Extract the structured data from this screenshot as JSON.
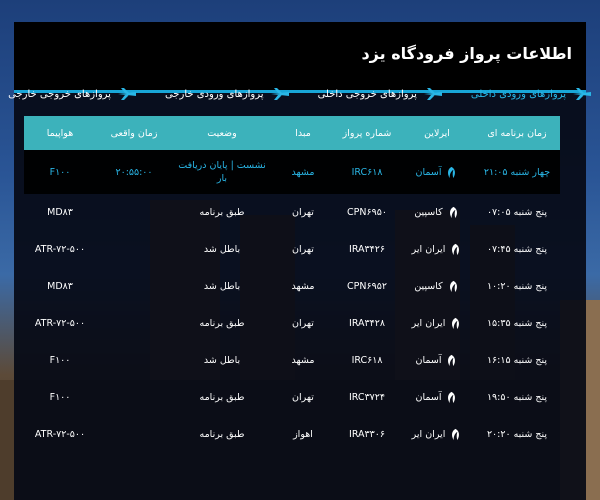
{
  "header": {
    "title": "اطلاعات پرواز فرودگاه یزد"
  },
  "tabs": [
    {
      "label": "پروازهای ورودی داخلی",
      "active": true
    },
    {
      "label": "پروازهای خروجی داخلی",
      "active": false
    },
    {
      "label": "پروازهای ورودی خارجی",
      "active": false
    },
    {
      "label": "پروازهای خروجی خارجی",
      "active": false
    }
  ],
  "table": {
    "columns": [
      "زمان برنامه ای",
      "ایرلاین",
      "شماره پرواز",
      "مبدا",
      "وضعیت",
      "زمان واقعی",
      "هواپیما"
    ],
    "rows": [
      {
        "scheduled": "چهار شنبه ۲۱:۰۵",
        "airline": "آسمان",
        "flight": "IRC۶۱۸",
        "origin": "مشهد",
        "status": "نشست | پایان دریافت بار",
        "actual": "۲۰:۵۵:۰۰",
        "aircraft": "F۱۰۰",
        "logo": "aseman-logo-icon"
      },
      {
        "scheduled": "پنج شنبه ۰۷:۰۵",
        "airline": "کاسپین",
        "flight": "CPN۶۹۵۰",
        "origin": "تهران",
        "status": "طبق برنامه",
        "actual": "",
        "aircraft": "MD۸۳",
        "logo": "caspian-logo-icon"
      },
      {
        "scheduled": "پنج شنبه ۰۷:۴۵",
        "airline": "ایران ایر",
        "flight": "IRA۳۴۲۶",
        "origin": "تهران",
        "status": "باطل شد",
        "actual": "",
        "aircraft": "ATR-۷۲-۵۰۰",
        "logo": "iranair-logo-icon"
      },
      {
        "scheduled": "پنج شنبه ۱۰:۲۰",
        "airline": "کاسپین",
        "flight": "CPN۶۹۵۲",
        "origin": "مشهد",
        "status": "باطل شد",
        "actual": "",
        "aircraft": "MD۸۳",
        "logo": "caspian-logo-icon"
      },
      {
        "scheduled": "پنج شنبه ۱۵:۳۵",
        "airline": "ایران ایر",
        "flight": "IRA۳۴۲۸",
        "origin": "تهران",
        "status": "طبق برنامه",
        "actual": "",
        "aircraft": "ATR-۷۲-۵۰۰",
        "logo": "iranair-logo-icon"
      },
      {
        "scheduled": "پنج شنبه ۱۶:۱۵",
        "airline": "آسمان",
        "flight": "IRC۶۱۸",
        "origin": "مشهد",
        "status": "باطل شد",
        "actual": "",
        "aircraft": "F۱۰۰",
        "logo": "aseman-logo-icon"
      },
      {
        "scheduled": "پنج شنبه ۱۹:۵۰",
        "airline": "آسمان",
        "flight": "IRC۳۷۲۴",
        "origin": "تهران",
        "status": "طبق برنامه",
        "actual": "",
        "aircraft": "F۱۰۰",
        "logo": "aseman-logo-icon"
      },
      {
        "scheduled": "پنج شنبه ۲۰:۲۰",
        "airline": "ایران ایر",
        "flight": "IRA۳۳۰۶",
        "origin": "اهواز",
        "status": "طبق برنامه",
        "actual": "",
        "aircraft": "ATR-۷۲-۵۰۰",
        "logo": "iranair-logo-icon"
      }
    ]
  },
  "colors": {
    "accent": "#29b6e6",
    "header_row": "#3cb2bb"
  }
}
